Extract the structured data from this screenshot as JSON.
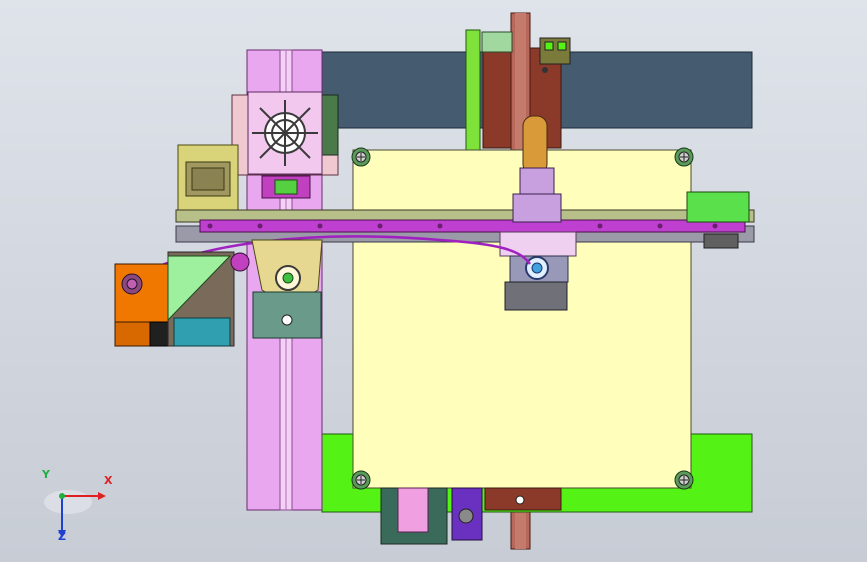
{
  "viewport": {
    "background_top": "#dfe3ea",
    "background_bottom": "#c7ccd5"
  },
  "triad": {
    "x_label": "X",
    "y_label": "Y",
    "z_label": "Z",
    "x_color": "#e02020",
    "y_color": "#20b040",
    "z_color": "#2040d0"
  },
  "colors": {
    "bed": "#ffffbb",
    "lilac_rail": "#e9a7ef",
    "slate_block": "#455b6f",
    "green_plate": "#55f215",
    "brown_column": "#9c3d2f",
    "purple_rail": "#bf3fd0",
    "orange_motor": "#f07800",
    "olive_motor": "#d9d47a"
  }
}
